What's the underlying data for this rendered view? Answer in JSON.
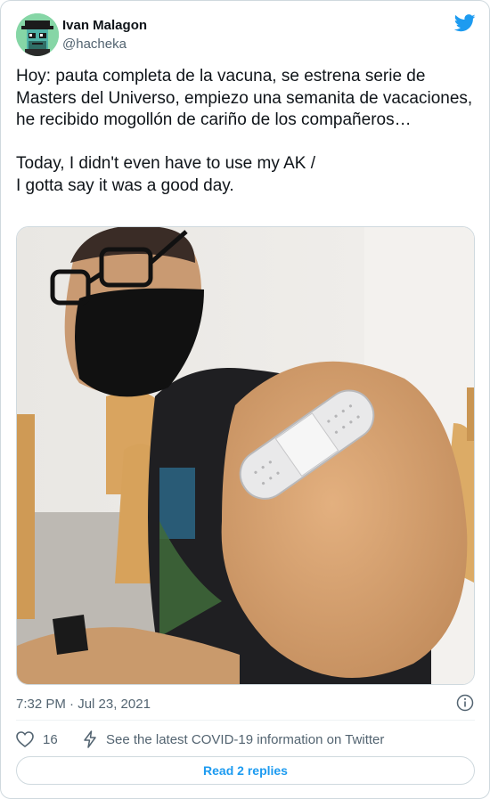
{
  "user": {
    "name": "Ivan Malagon",
    "handle": "@hacheka"
  },
  "tweet": {
    "text": "Hoy: pauta completa de la vacuna, se estrena serie de Masters del Universo, empiezo una semanita de vacaciones, he recibido mogollón de cariño de los compañeros…\n\nToday, I didn't even have to use my AK /\nI gotta say it was a good day.",
    "timestamp": "7:32 PM · Jul 23, 2021"
  },
  "actions": {
    "likes_count": "16",
    "covid_info": "See the latest COVID-19 information on Twitter",
    "read_replies": "Read 2 replies"
  },
  "icons": {
    "brand": "twitter-bird-icon",
    "like": "heart-icon",
    "covid": "lightning-icon",
    "info": "info-icon"
  },
  "colors": {
    "brand": "#1d9bf0",
    "secondary_text": "#536471",
    "border": "#cfd9de"
  }
}
